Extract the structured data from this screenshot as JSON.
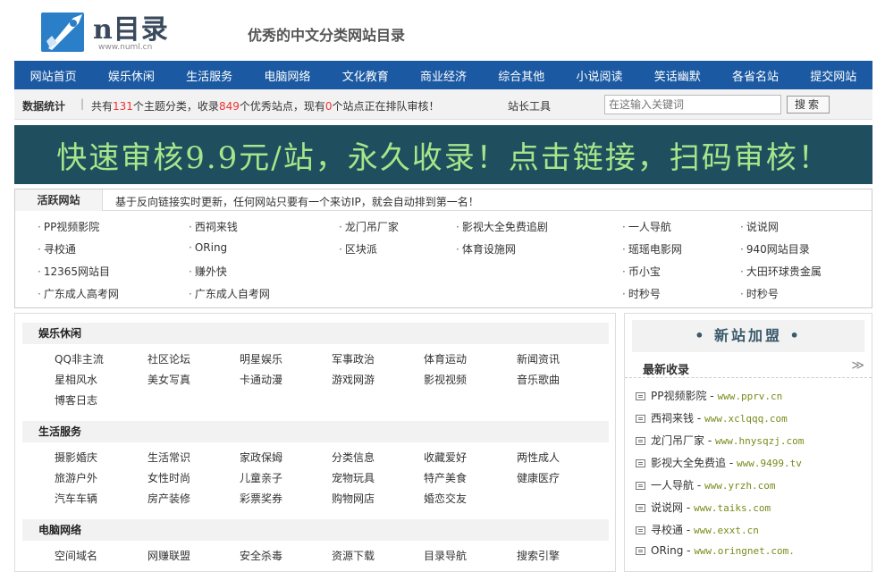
{
  "header": {
    "logo_text": "n目录",
    "logo_url": "www.numl.cn",
    "slogan": "优秀的中文分类网站目录"
  },
  "nav": [
    "网站首页",
    "娱乐休闲",
    "生活服务",
    "电脑网络",
    "文化教育",
    "商业经济",
    "综合其他",
    "小说阅读",
    "笑话幽默",
    "各省名站",
    "提交网站"
  ],
  "stats": {
    "label": "数据统计",
    "sep": "|",
    "t1": "共有",
    "topics": "131",
    "t2": "个主题分类，收录",
    "sites": "849",
    "t3": "个优秀站点，现有",
    "pending": "0",
    "t4": "个站点正在排队审核！",
    "tools": "站长工具",
    "search_placeholder": "在这输入关键词",
    "search_btn": "搜索"
  },
  "banner": {
    "text": "快速审核9.9元/站，永久收录！点击链接，扫码审核！"
  },
  "active": {
    "title": "活跃网站",
    "desc": "基于反向链接实时更新，任何网站只要有一个来访IP，就会自动排到第一名！",
    "col1": [
      "PP视频影院",
      "寻校通",
      "12365网站目",
      "广东成人高考网"
    ],
    "col2": [
      "西祠来钱",
      "ORing",
      "赚外快",
      "广东成人自考网"
    ],
    "col3": [
      "龙门吊厂家",
      "区块派"
    ],
    "col4": [
      "影视大全免费追剧",
      "体育设施网"
    ],
    "col5": [
      "一人导航",
      "瑶瑶电影网",
      "币小宝",
      "时秒号"
    ],
    "col6": [
      "说说网",
      "940网站目录",
      "大田环球贵金属",
      "时秒号"
    ]
  },
  "categories": [
    {
      "title": "娱乐休闲",
      "rows": [
        [
          "QQ非主流",
          "社区论坛",
          "明星娱乐",
          "军事政治",
          "体育运动",
          "新闻资讯"
        ],
        [
          "星相风水",
          "美女写真",
          "卡通动漫",
          "游戏网游",
          "影视视频",
          "音乐歌曲"
        ],
        [
          "博客日志"
        ]
      ]
    },
    {
      "title": "生活服务",
      "rows": [
        [
          "摄影婚庆",
          "生活常识",
          "家政保姆",
          "分类信息",
          "收藏爱好",
          "两性成人"
        ],
        [
          "旅游户外",
          "女性时尚",
          "儿童亲子",
          "宠物玩具",
          "特产美食",
          "健康医疗"
        ],
        [
          "汽车车辆",
          "房产装修",
          "彩票奖券",
          "购物网店",
          "婚恋交友"
        ]
      ]
    },
    {
      "title": "电脑网络",
      "rows": [
        [
          "空间域名",
          "网赚联盟",
          "安全杀毒",
          "资源下载",
          "目录导航",
          "搜索引擎"
        ]
      ]
    }
  ],
  "right": {
    "join": "• 新站加盟 •",
    "newest": "最新收录",
    "more": "≫",
    "records": [
      {
        "name": "PP视频影院",
        "url": "www.pprv.cn"
      },
      {
        "name": "西祠来钱",
        "url": "www.xclqqq.com"
      },
      {
        "name": "龙门吊厂家",
        "url": "www.hnysqzj.com"
      },
      {
        "name": "影视大全免费追",
        "url": "www.9499.tv"
      },
      {
        "name": "一人导航",
        "url": "www.yrzh.com"
      },
      {
        "name": "说说网",
        "url": "www.taiks.com"
      },
      {
        "name": "寻校通",
        "url": "www.exxt.cn"
      },
      {
        "name": "ORing",
        "url": "www.oringnet.com."
      }
    ],
    "sep": " - "
  }
}
